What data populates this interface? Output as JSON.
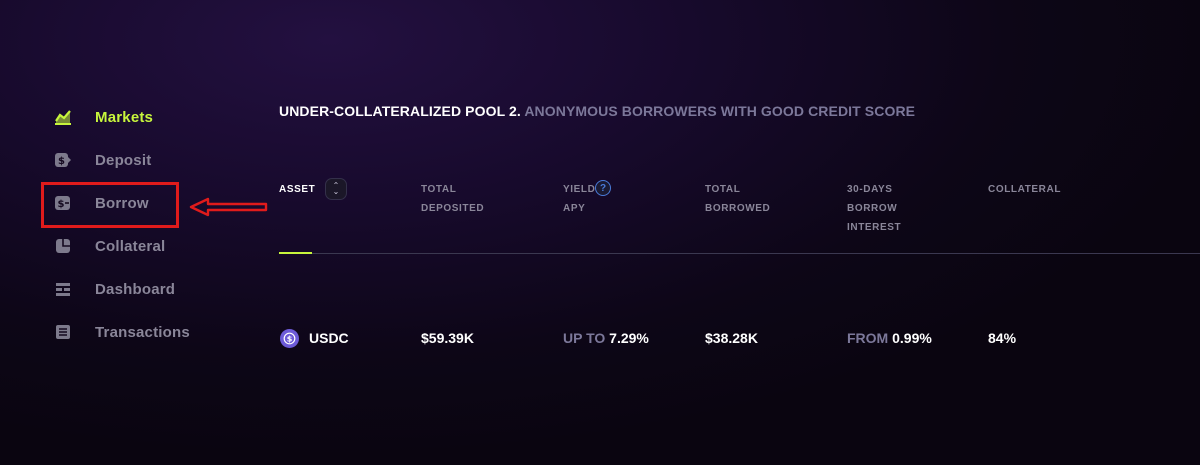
{
  "sidebar": {
    "items": [
      {
        "label": "Markets",
        "icon": "chart-up-icon",
        "active": true
      },
      {
        "label": "Deposit",
        "icon": "deposit-coin-icon",
        "active": false
      },
      {
        "label": "Borrow",
        "icon": "borrow-coin-icon",
        "active": false
      },
      {
        "label": "Collateral",
        "icon": "pie-chart-icon",
        "active": false
      },
      {
        "label": "Dashboard",
        "icon": "dashboard-icon",
        "active": false
      },
      {
        "label": "Transactions",
        "icon": "document-icon",
        "active": false
      }
    ]
  },
  "pool": {
    "title_strong": "UNDER-COLLATERALIZED POOL 2.",
    "title_muted": "ANONYMOUS BORROWERS WITH GOOD CREDIT SCORE"
  },
  "table": {
    "headers": [
      {
        "line1": "ASSET",
        "line2": ""
      },
      {
        "line1": "TOTAL",
        "line2": "DEPOSITED"
      },
      {
        "line1": "YIELD",
        "line2": "APY"
      },
      {
        "line1": "TOTAL",
        "line2": "BORROWED"
      },
      {
        "line1": "30-DAYS",
        "line2": "BORROW",
        "line3": "INTEREST"
      },
      {
        "line1": "COLLATERAL",
        "line2": ""
      }
    ],
    "help_symbol": "?",
    "rows": [
      {
        "asset": "USDC",
        "total_deposited": "$59.39K",
        "yield_prefix": "UP TO",
        "yield_value": "7.29%",
        "total_borrowed": "$38.28K",
        "interest_prefix": "FROM",
        "interest_value": "0.99%",
        "collateral": "84%"
      }
    ]
  },
  "colors": {
    "accent": "#c7f53c",
    "muted_text": "#8a8699",
    "annotation": "#e01b1b",
    "usdc": "#6d5bd8"
  }
}
